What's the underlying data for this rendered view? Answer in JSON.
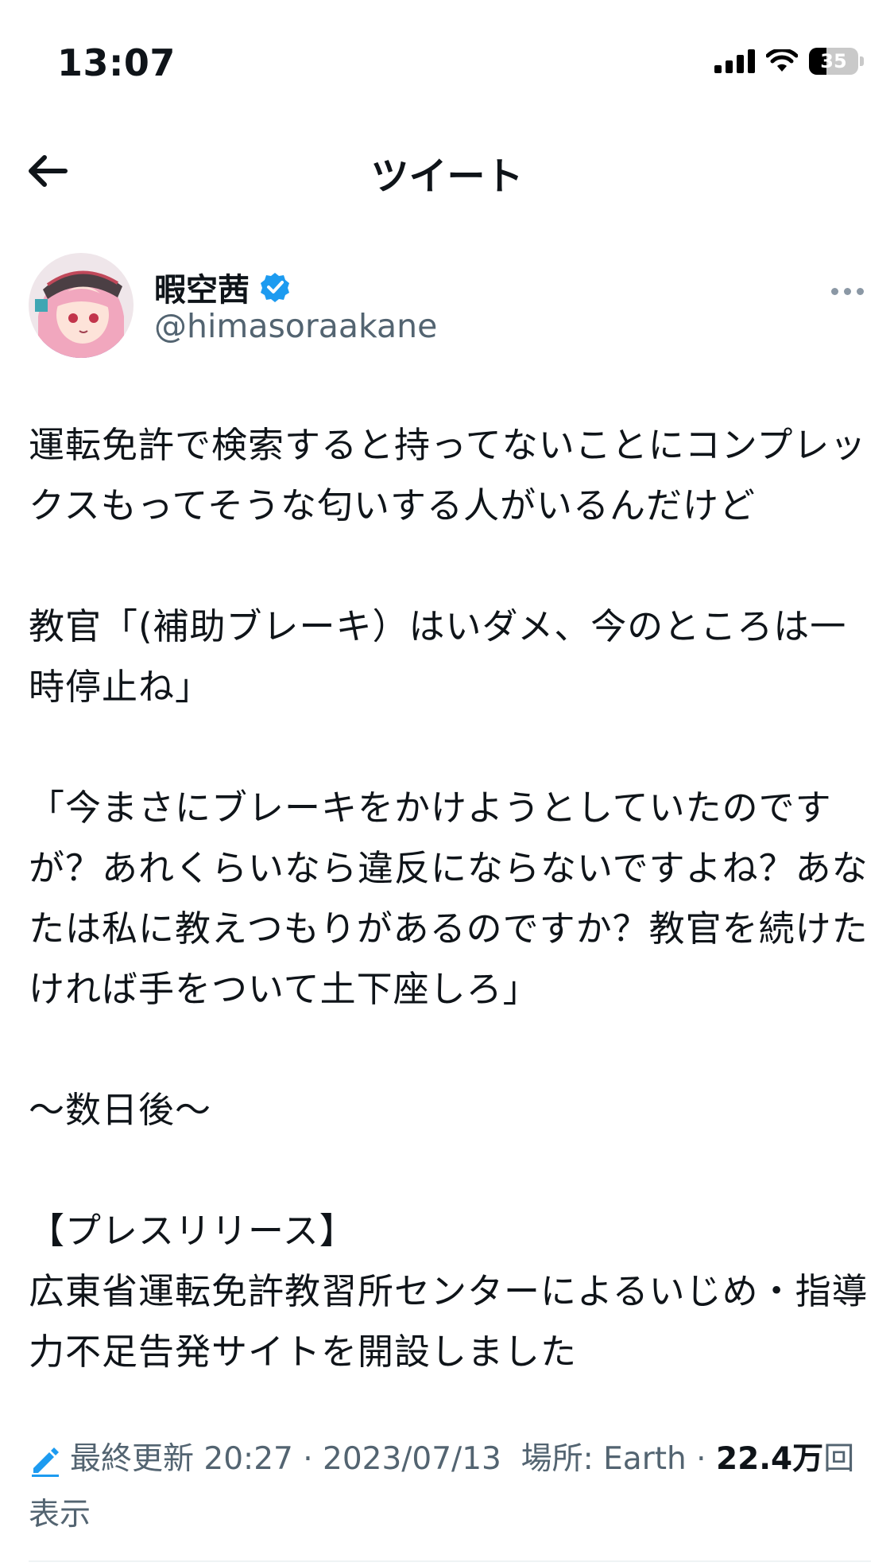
{
  "status_bar": {
    "time": "13:07",
    "battery": "35",
    "battery_level": 0.35
  },
  "nav": {
    "title": "ツイート"
  },
  "author": {
    "display_name": "暇空茜",
    "handle": "@himasoraakane",
    "verified": true
  },
  "tweet": {
    "text": "運転免許で検索すると持ってないことにコンプレックスもってそうな匂いする人がいるんだけど\n\n教官「(補助ブレーキ）はいダメ、今のところは一時停止ね」\n\n「今まさにブレーキをかけようとしていたのですが？あれくらいなら違反にならないですよね？あなたは私に教えつもりがあるのですか？教官を続けたければ手をついて土下座しろ」\n\n〜数日後〜\n\n【プレスリリース】\n広東省運転免許教習所センターによるいじめ・指導力不足告発サイトを開設しました"
  },
  "meta": {
    "edited_label": "最終更新",
    "time": "20:27",
    "date": "2023/07/13",
    "location": "場所: Earth",
    "views_count": "22.4万",
    "views_suffix": "回表示"
  },
  "colors": {
    "text": "#0f1419",
    "secondary": "#536471",
    "verified_blue": "#1d9bf0"
  }
}
